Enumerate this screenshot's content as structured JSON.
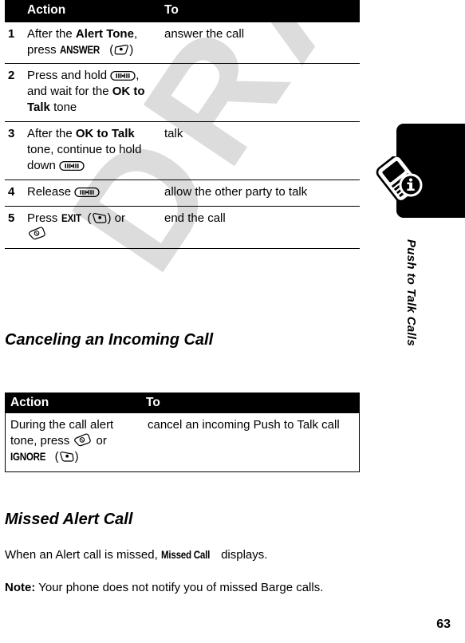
{
  "page": {
    "number": "63",
    "watermark": "DRAFT"
  },
  "sidebar": {
    "label": "Push to Talk Calls",
    "icon": "phone-info-icon"
  },
  "table1": {
    "headers": {
      "action": "Action",
      "to": "To"
    },
    "rows": [
      {
        "num": "1",
        "action_parts": {
          "p1": "After the ",
          "b1": "Alert Tone",
          "p2": ", press ",
          "softkey": "ANSWER",
          "icon": "left-softkey-icon"
        },
        "to": "answer the call"
      },
      {
        "num": "2",
        "action_parts": {
          "p1": "Press and hold ",
          "icon": "ptt-key-icon",
          "p2": ", and wait for the ",
          "b1": "OK to Talk",
          "p3": " tone"
        },
        "to": ""
      },
      {
        "num": "3",
        "action_parts": {
          "p1": "After the ",
          "b1": "OK to Talk",
          "p2": " tone, continue to hold down ",
          "icon": "ptt-key-icon"
        },
        "to": "talk"
      },
      {
        "num": "4",
        "action_parts": {
          "p1": "Release ",
          "icon": "ptt-key-icon"
        },
        "to": "allow the other party to talk"
      },
      {
        "num": "5",
        "action_parts": {
          "p1": "Press ",
          "softkey": "EXIT",
          "icon": "right-softkey-icon",
          "p2": " or ",
          "icon2": "end-call-key-icon"
        },
        "to": "end the call"
      }
    ]
  },
  "heading1": "Canceling an Incoming Call",
  "table2": {
    "headers": {
      "action": "Action",
      "to": "To"
    },
    "row": {
      "action_parts": {
        "p1": "During the call alert tone, press ",
        "icon": "end-call-key-icon",
        "p2": " or ",
        "softkey": "IGNORE",
        "icon2": "right-softkey-icon"
      },
      "to": "cancel an incoming Push to Talk call"
    }
  },
  "heading2": "Missed Alert Call",
  "paragraph1": {
    "p1": "When an Alert call is missed, ",
    "display": "Missed Call",
    "p2": " displays."
  },
  "paragraph2": {
    "label": "Note:",
    "text": " Your phone does not notify you of missed Barge calls."
  }
}
